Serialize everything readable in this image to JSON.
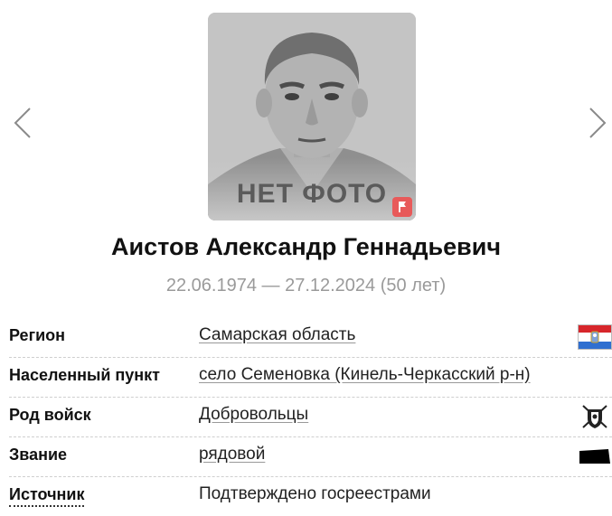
{
  "photo": {
    "placeholder_text": "НЕТ ФОТО"
  },
  "person": {
    "name": "Аистов Александр Геннадьевич",
    "dates": "22.06.1974 — 27.12.2024 (50 лет)"
  },
  "details": [
    {
      "label": "Регион",
      "value": "Самарская область",
      "icon": "samara-region-flag-icon"
    },
    {
      "label": "Населенный пункт",
      "value": "село Семеновка (Кинель-Черкасский р-н)"
    },
    {
      "label": "Род войск",
      "value": "Добровольцы",
      "icon": "volunteers-emblem-icon"
    },
    {
      "label": "Звание",
      "value": "рядовой",
      "icon": "private-rank-insignia-icon"
    },
    {
      "label": "Источник",
      "value": "Подтверждено госреестрами"
    }
  ],
  "colors": {
    "flag_badge": "#e85a5a",
    "dates_text": "#9a9a9a",
    "region_flag_red": "#d7262b",
    "region_flag_blue": "#2f6fd0"
  }
}
